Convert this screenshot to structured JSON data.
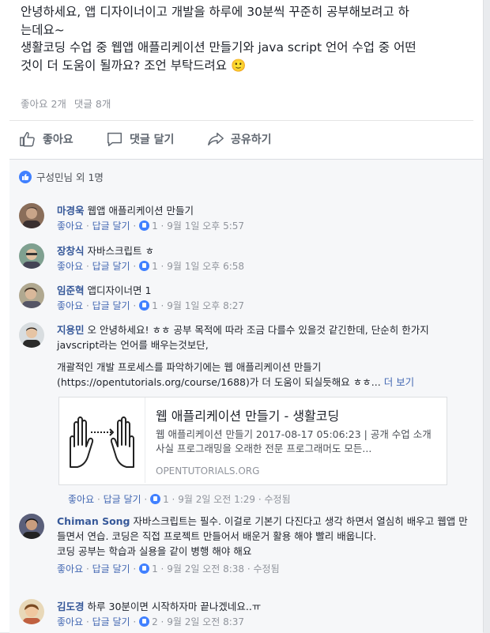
{
  "post": {
    "lines": [
      "안녕하세요, 앱 디자이너이고 개발을 하루에 30분씩 꾸준히 공부해보려고 하",
      "는데요~",
      "생활코딩 수업 중 웹앱 애플리케이션 만들기와 java script 언어 수업 중 어떤",
      "것이 더 도움이 될까요? 조언 부탁드려요 🙂"
    ],
    "likes_count": "좋아요 2개",
    "comments_count": "댓글 8개"
  },
  "actions": {
    "like": "좋아요",
    "comment": "댓글 달기",
    "share": "공유하기"
  },
  "reactors": "구성민님 외 1명",
  "comment_meta_labels": {
    "like": "좋아요",
    "reply": "답글 달기",
    "dot": "·"
  },
  "comments": [
    {
      "name": "마경욱",
      "text": "웹앱 애플리케이션 만들기",
      "likes": "1",
      "time": "9월 1일 오후 5:57",
      "edited": ""
    },
    {
      "name": "장창식",
      "text": "자바스크립트 ㅎ",
      "likes": "1",
      "time": "9월 1일 오후 6:58",
      "edited": ""
    },
    {
      "name": "임준혁",
      "text": "앱디자이너면 1",
      "likes": "1",
      "time": "9월 1일 오후 8:27",
      "edited": ""
    },
    {
      "name": "지용민",
      "text": "오 안녕하세요! ㅎㅎ 공부 목적에 따라 조금 다를수 있을것 같긴한데, 단순히 한가지 javscript라는 언어를 배우는것보단,",
      "text2": "개괄적인 개발 프로세스를 파악하기에는 웹 애플리케이션 만들기 (https://opentutorials.org/course/1688)가 더 도움이 되실듯해요 ㅎㅎ...",
      "more": "더 보기",
      "likes": "1",
      "time": "9월 2일 오전 1:29",
      "edited": "수정됨"
    },
    {
      "name": "Chiman Song",
      "text": "자바스크립트는 필수. 이걸로 기본기 다진다고 생각 하면서 열심히 배우고 웹앱 만들면서 연습. 코딩은 직접 프로젝트 만들어서 배운거 활용 해야 빨리 배웁니다.",
      "text2": "코딩 공부는 학습과 실용을 같이 병행 해야 해요",
      "likes": "1",
      "time": "9월 2일 오전 8:38",
      "edited": "수정됨"
    },
    {
      "name": "김도경",
      "text": "하루 30분이면 시작하자마 끝나겠네요..ㅠ",
      "likes": "2",
      "time": "9월 2일 오전 8:37",
      "edited": ""
    }
  ],
  "link_preview": {
    "title": "웹 애플리케이션 만들기 - 생활코딩",
    "desc": "웹 애플리케이션 만들기 2017-08-17 05:06:23 | 공개 수업 소개 사실 프로그래밍을 오래한 전문 프로그래머도 모든...",
    "domain": "OPENTUTORIALS.ORG"
  },
  "colors": {
    "link": "#365899",
    "accent": "#4080ff",
    "meta": "#90949c"
  }
}
